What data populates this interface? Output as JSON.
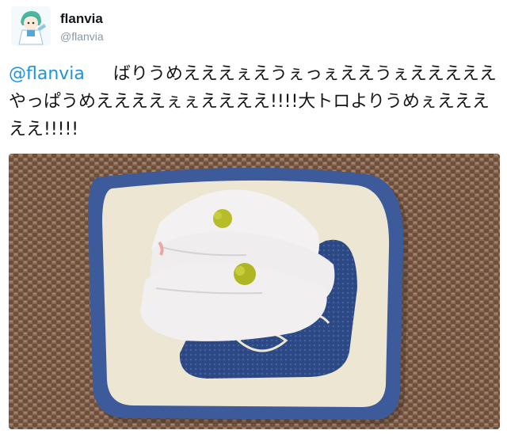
{
  "user": {
    "display_name": "flanvia",
    "handle": "@flanvia",
    "avatar_icon": "anime-character-avatar-icon"
  },
  "tweet": {
    "mention": "@flanvia",
    "text": "ばりうめえええぇえうぇっぇええうぇえええええやっぱうめええええぇぇええええ!!!!大トロよりうめぇえええええ!!!!!"
  },
  "photo": {
    "subject": "sashimi-plate-photo",
    "colors": {
      "mat": "#7a5a46",
      "plate_rim": "#3d5a9a",
      "plate_base": "#ece6d2",
      "fish": "#f1efef",
      "wasabi": "#b7bc2a"
    }
  }
}
